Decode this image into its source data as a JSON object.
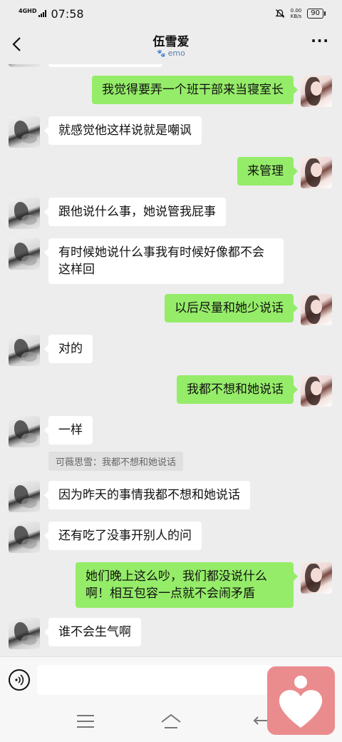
{
  "status_bar": {
    "network": "4GHD",
    "time": "07:58",
    "speed_value": "0.00",
    "speed_unit": "KB/s",
    "battery": "90"
  },
  "header": {
    "title": "伍雪爱",
    "status_text": "emo"
  },
  "messages": [
    {
      "side": "right",
      "text": "我觉得要弄一个班干部来当寝室长"
    },
    {
      "side": "left",
      "text": "就感觉他这样说就是嘲讽"
    },
    {
      "side": "right",
      "text": "来管理"
    },
    {
      "side": "left",
      "text": "跟他说什么事，她说管我屁事"
    },
    {
      "side": "left",
      "text": "有时候她说什么事我有时候好像都不会这样回"
    },
    {
      "side": "right",
      "text": "以后尽量和她少说话"
    },
    {
      "side": "left",
      "text": "对的"
    },
    {
      "side": "right",
      "text": "我都不想和她说话"
    },
    {
      "side": "left",
      "text": "一样"
    },
    {
      "side": "left",
      "text": "因为昨天的事情我都不想和她说话"
    },
    {
      "side": "left",
      "text": "还有吃了没事开别人的问"
    },
    {
      "side": "right",
      "text": "她们晚上这么吵，我们都没说什么啊！相互包容一点就不会闹矛盾"
    },
    {
      "side": "left",
      "text": "谁不会生气啊"
    }
  ],
  "quote": "可薇思雪：我都不想和她说话",
  "input": {
    "placeholder": ""
  },
  "colors": {
    "self_bubble": "#95ec69",
    "other_bubble": "#ffffff",
    "background": "#ededed",
    "heart_widget": "#ea8c8e"
  },
  "icons": {
    "back": "back-arrow-icon",
    "more": "more-dots-icon",
    "voice": "voice-icon",
    "nav_menu": "menu-icon",
    "nav_home": "home-icon",
    "nav_back": "nav-back-icon",
    "heart": "heart-person-icon"
  }
}
